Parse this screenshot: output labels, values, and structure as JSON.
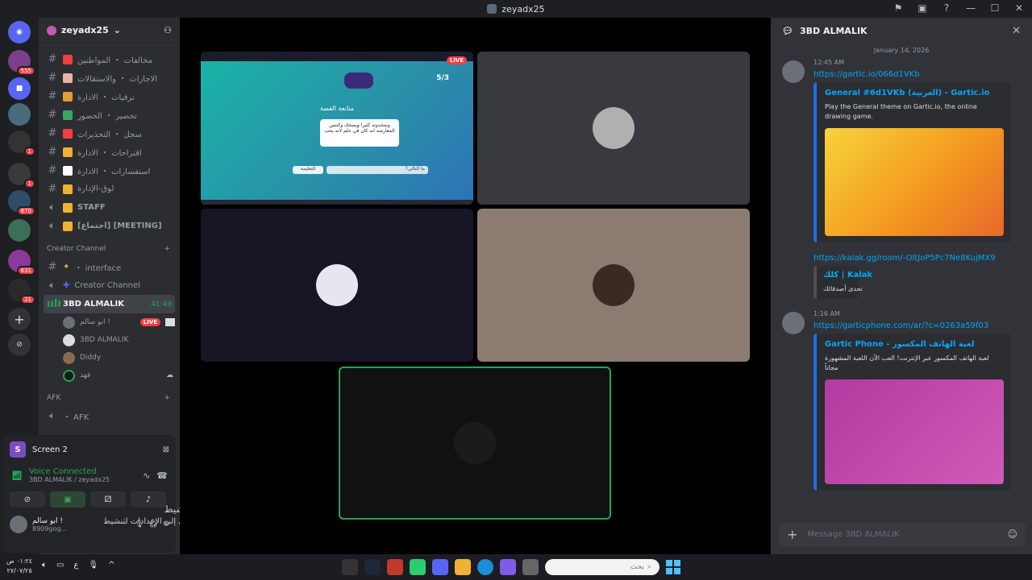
{
  "window": {
    "title": "zeyadx25"
  },
  "servers": [
    {
      "badge": ""
    },
    {
      "badge": "555"
    },
    {
      "badge": ""
    },
    {
      "badge": ""
    },
    {
      "badge": "1"
    },
    {
      "badge": "1"
    },
    {
      "badge": "870"
    },
    {
      "badge": ""
    },
    {
      "badge": "631"
    },
    {
      "badge": "21"
    }
  ],
  "guild": {
    "name": "zeyadx25"
  },
  "channels": [
    {
      "label": "مخالفات ・ المواطنين",
      "color": "#f23f43"
    },
    {
      "label": "الاجازات ・ والاستقالات",
      "color": "#e7b6a3"
    },
    {
      "label": "ترقيات ・ الادارة",
      "color": "#e69b33"
    },
    {
      "label": "تحضير ・ الحضور",
      "color": "#3ba55d"
    },
    {
      "label": "سجل ・ التحذيرات",
      "color": "#f23f43"
    },
    {
      "label": "اقتراحات ・ الادارة",
      "color": "#f0b232"
    },
    {
      "label": "استفسارات ・ الادارة",
      "color": "#ffffff"
    },
    {
      "label": "لوق-الإدارة",
      "color": "#f0b232"
    },
    {
      "label": "STAFF",
      "color": "#f0b232"
    },
    {
      "label": "[اجتماع] [MEETING]",
      "color": "#f0b232"
    }
  ],
  "creator": {
    "category": "Creator Channel",
    "interface": "・ interface",
    "creator_channel": "Creator Channel",
    "voice_channel": "3BD ALMALIK",
    "timer": "41:49",
    "members": [
      {
        "name": "ابو سالم !",
        "live": "LIVE"
      },
      {
        "name": "3BD ALMALIK"
      },
      {
        "name": "Diddy"
      },
      {
        "name": "فهد"
      }
    ]
  },
  "afk": {
    "category": "AFK",
    "channel": "・ AFK"
  },
  "screen_panel": {
    "title": "Screen 2",
    "status": "Voice Connected",
    "sub": "3BD ALMALIK / zeyadx25"
  },
  "user": {
    "name": "ابو سالم !",
    "tag": "8909gog..."
  },
  "watermark": {
    "line1": "تنشيط Windows",
    "line2": "انتقل إلى الإعدادات لتنشيط Windows."
  },
  "stage": {
    "live": "LIVE",
    "game": {
      "title": "متابعة القصة",
      "count": "5/3",
      "card": "ويمحدونه كثيرا ويضحك وكنتس المعارضه انه كان في حلم لانه يحب",
      "input": "ما التالي؟",
      "button": "التعليمة"
    }
  },
  "rpanel": {
    "title": "3BD ALMALIK",
    "date": "January 14, 2026",
    "messages": [
      {
        "time": "12:45 AM",
        "link": "https://gartic.io/066d1VKb",
        "embed_title": "General #6d1VKb (العربية) - Gartic.io",
        "embed_desc": "Play the General theme on Gartic.io, the online drawing game.",
        "link2": "https://kalak.gg/room/-OitJoP5Pc7Ne8KujMX9",
        "embed2_title": "كلك | Kalak",
        "embed2_desc": "تحدى أصدقائك"
      },
      {
        "time": "1:16 AM",
        "link": "https://garticphone.com/ar/?c=0263a59f03",
        "embed_title": "Gartic Phone - لعبة الهاتف المكسور",
        "embed_desc": "لعبة الهاتف المكسور عبر الإنترنت! العب الآن اللعبة المشهورة مجاناً"
      }
    ],
    "placeholder": "Message 3BD ALMALIK"
  },
  "taskbar": {
    "time": "٠١:٢٤ ص",
    "date": "٢٧/٠٧/٢٥",
    "lang": "ع",
    "search": "بحث"
  }
}
